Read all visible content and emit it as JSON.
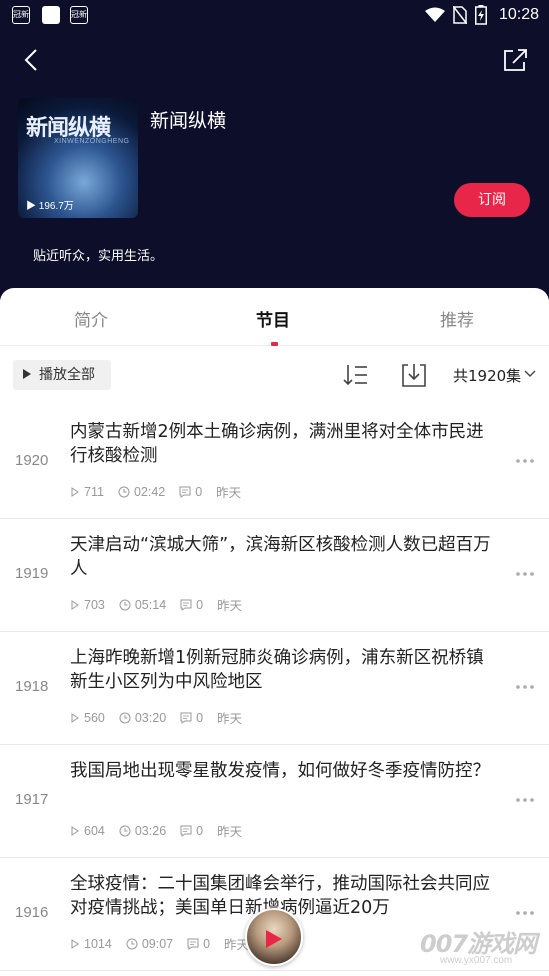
{
  "status_bar": {
    "time": "10:28",
    "notif_icon_text": "冠新"
  },
  "header": {
    "podcast_title": "新闻纵横",
    "cover_title": "新闻纵横",
    "cover_subtitle": "XINWENZONGHENG",
    "play_count": "196.7万",
    "subscribe_label": "订阅",
    "description": "贴近听众，实用生活。"
  },
  "tabs": [
    {
      "label": "简介",
      "active": false
    },
    {
      "label": "节目",
      "active": true
    },
    {
      "label": "推荐",
      "active": false
    }
  ],
  "toolbar": {
    "play_all_label": "播放全部",
    "episode_count": "共1920集"
  },
  "episodes": [
    {
      "number": "1920",
      "title": "内蒙古新增2例本土确诊病例，满洲里将对全体市民进行核酸检测",
      "plays": "711",
      "duration": "02:42",
      "comments": "0",
      "date": "昨天"
    },
    {
      "number": "1919",
      "title": "天津启动“滨城大筛”，滨海新区核酸检测人数已超百万人",
      "plays": "703",
      "duration": "05:14",
      "comments": "0",
      "date": "昨天"
    },
    {
      "number": "1918",
      "title": "上海昨晚新增1例新冠肺炎确诊病例，浦东新区祝桥镇新生小区列为中风险地区",
      "plays": "560",
      "duration": "03:20",
      "comments": "0",
      "date": "昨天"
    },
    {
      "number": "1917",
      "title": "我国局地出现零星散发疫情，如何做好冬季疫情防控？",
      "plays": "604",
      "duration": "03:26",
      "comments": "0",
      "date": "昨天"
    },
    {
      "number": "1916",
      "title": "全球疫情：二十国集团峰会举行，推动国际社会共同应对疫情挑战；美国单日新增病例逼近20万",
      "plays": "1014",
      "duration": "09:07",
      "comments": "0",
      "date": "昨天"
    }
  ],
  "watermark": {
    "main": "007游戏网",
    "sub": "www.yx007.com"
  },
  "colors": {
    "header_bg": "#0d0f2a",
    "accent": "#e8264a"
  }
}
